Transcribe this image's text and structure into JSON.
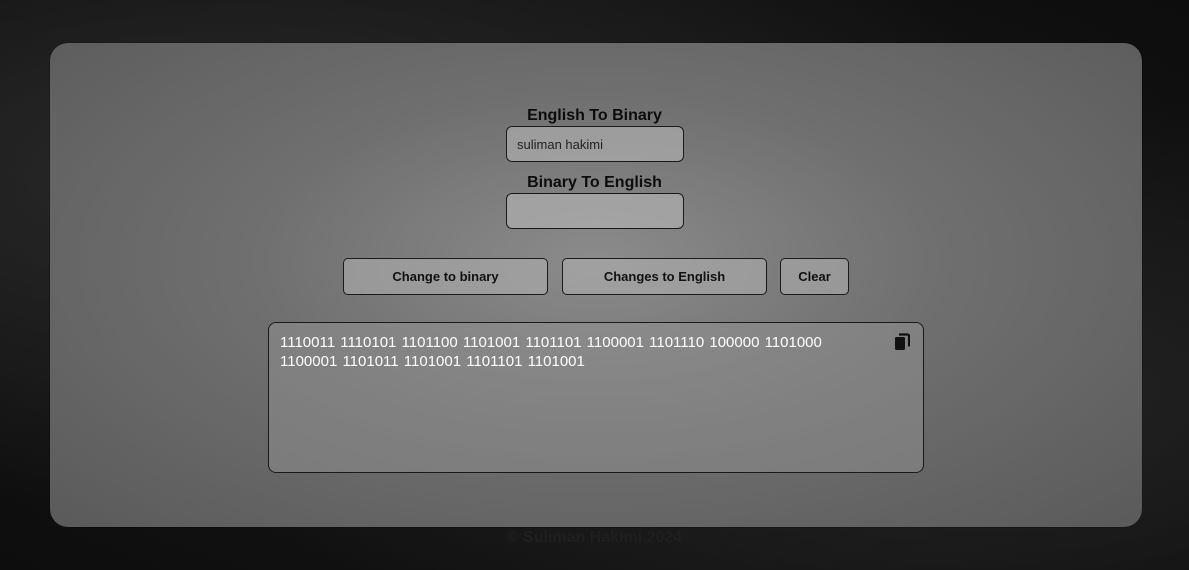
{
  "converter": {
    "english_label": "English To Binary",
    "english_value": "suliman hakimi",
    "binary_label": "Binary To English",
    "binary_value": ""
  },
  "buttons": {
    "to_binary": "Change to binary",
    "to_english": "Changes to English",
    "clear": "Clear"
  },
  "output": {
    "text": "1110011 1110101 1101100 1101001 1101101 1100001 1101110 100000 1101000 1100001 1101011 1101001 1101101 1101001",
    "copy_icon": "copy-icon"
  },
  "footer": {
    "text": "© Suliman Hakimi 2024"
  }
}
